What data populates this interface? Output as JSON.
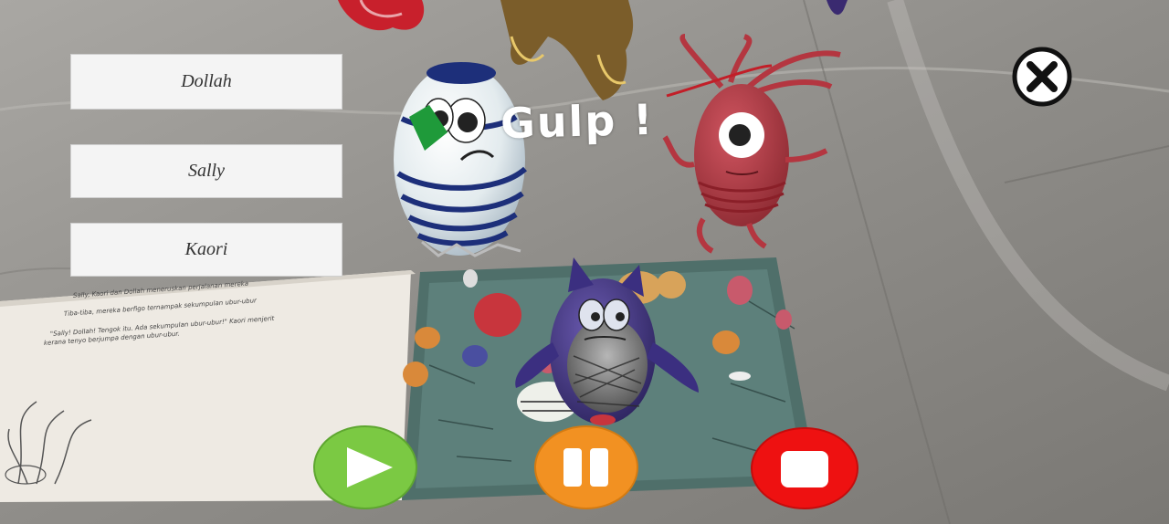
{
  "characters": [
    {
      "label": "Dollah"
    },
    {
      "label": "Sally"
    },
    {
      "label": "Kaori"
    }
  ],
  "ar_scene": {
    "sound_effect": "Gulp !",
    "book_text": [
      "Sally, Kaori dan Dollah meneruskan perjalanan mereka",
      "Tiba-tiba, mereka berfigo ternampak sekumpulan ubur-ubur",
      "\"Sally! Dollah! Tengok itu. Ada sekumpulan ubur-ubur!\" Kaori menjerit",
      "kerana tenyo berjumpa dengan ubur-ubur."
    ]
  },
  "controls": {
    "close_icon": "close-circle-icon",
    "play_icon": "play-icon",
    "pause_icon": "pause-icon",
    "stop_icon": "stop-icon",
    "play_color": "#7bc943",
    "pause_color": "#f29122",
    "stop_color": "#ee1111"
  }
}
